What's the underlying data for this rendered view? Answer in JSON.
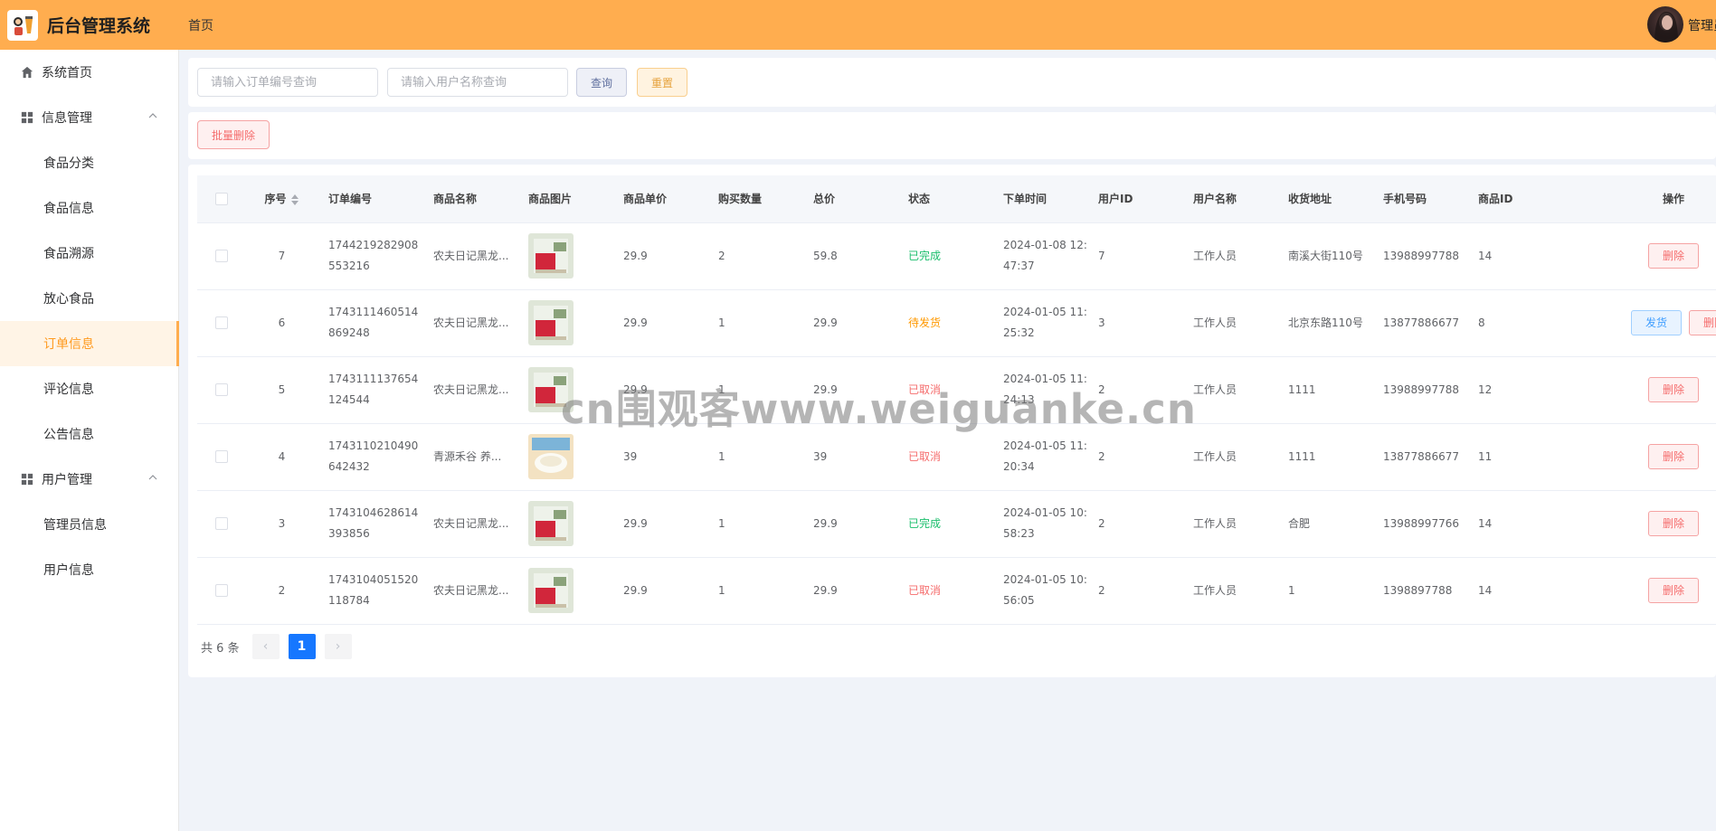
{
  "header": {
    "app_title": "后台管理系统",
    "nav_home": "首页",
    "user_name": "管理员"
  },
  "sidebar": {
    "items": [
      {
        "label": "系统首页",
        "icon": "home-icon"
      },
      {
        "label": "信息管理",
        "icon": "grid-icon"
      },
      {
        "label": "食品分类"
      },
      {
        "label": "食品信息"
      },
      {
        "label": "食品溯源"
      },
      {
        "label": "放心食品"
      },
      {
        "label": "订单信息"
      },
      {
        "label": "评论信息"
      },
      {
        "label": "公告信息"
      },
      {
        "label": "用户管理",
        "icon": "grid-icon"
      },
      {
        "label": "管理员信息"
      },
      {
        "label": "用户信息"
      }
    ]
  },
  "search": {
    "order_placeholder": "请输入订单编号查询",
    "user_placeholder": "请输入用户名称查询",
    "query_label": "查询",
    "reset_label": "重置"
  },
  "actions": {
    "batch_delete_label": "批量删除"
  },
  "table": {
    "columns": {
      "seq": "序号",
      "order_no": "订单编号",
      "goods_name": "商品名称",
      "goods_img": "商品图片",
      "unit_price": "商品单价",
      "qty": "购买数量",
      "total": "总价",
      "status": "状态",
      "order_time": "下单时间",
      "user_id": "用户ID",
      "user_name": "用户名称",
      "address": "收货地址",
      "phone": "手机号码",
      "goods_id": "商品ID",
      "op": "操作"
    },
    "ship_label": "发货",
    "delete_label": "删除",
    "rows": [
      {
        "seq": "7",
        "order_no": "1744219282908553216",
        "goods_name": "农夫日记黑龙...",
        "unit_price": "29.9",
        "qty": "2",
        "total": "59.8",
        "status": "已完成",
        "order_time": "2024-01-08 12:47:37",
        "user_id": "7",
        "user_name": "工作人员",
        "address": "南溪大街110号",
        "phone": "13988997788",
        "goods_id": "14"
      },
      {
        "seq": "6",
        "order_no": "1743111460514869248",
        "goods_name": "农夫日记黑龙...",
        "unit_price": "29.9",
        "qty": "1",
        "total": "29.9",
        "status": "待发货",
        "order_time": "2024-01-05 11:25:32",
        "user_id": "3",
        "user_name": "工作人员",
        "address": "北京东路110号",
        "phone": "13877886677",
        "goods_id": "8"
      },
      {
        "seq": "5",
        "order_no": "1743111137654124544",
        "goods_name": "农夫日记黑龙...",
        "unit_price": "29.9",
        "qty": "1",
        "total": "29.9",
        "status": "已取消",
        "order_time": "2024-01-05 11:24:13",
        "user_id": "2",
        "user_name": "工作人员",
        "address": "1111",
        "phone": "13988997788",
        "goods_id": "12"
      },
      {
        "seq": "4",
        "order_no": "1743110210490642432",
        "goods_name": "青源禾谷 养...",
        "unit_price": "39",
        "qty": "1",
        "total": "39",
        "status": "已取消",
        "order_time": "2024-01-05 11:20:34",
        "user_id": "2",
        "user_name": "工作人员",
        "address": "1111",
        "phone": "13877886677",
        "goods_id": "11"
      },
      {
        "seq": "3",
        "order_no": "1743104628614393856",
        "goods_name": "农夫日记黑龙...",
        "unit_price": "29.9",
        "qty": "1",
        "total": "29.9",
        "status": "已完成",
        "order_time": "2024-01-05 10:58:23",
        "user_id": "2",
        "user_name": "工作人员",
        "address": "合肥",
        "phone": "13988997766",
        "goods_id": "14"
      },
      {
        "seq": "2",
        "order_no": "1743104051520118784",
        "goods_name": "农夫日记黑龙...",
        "unit_price": "29.9",
        "qty": "1",
        "total": "29.9",
        "status": "已取消",
        "order_time": "2024-01-05 10:56:05",
        "user_id": "2",
        "user_name": "工作人员",
        "address": "1",
        "phone": "1398897788",
        "goods_id": "14"
      }
    ]
  },
  "pagination": {
    "total_text": "共 6 条",
    "current_page": "1",
    "prev_icon": "chevron-left-icon",
    "next_icon": "chevron-right-icon"
  },
  "watermark": "cn围观客www.weiguanke.cn",
  "colors": {
    "header_bg": "#ffad4f",
    "active_menu": "#ff9a1f",
    "status_done": "#19be6b",
    "status_pending": "#ff9900",
    "status_cancel": "#f56c6c",
    "primary": "#1677ff"
  }
}
